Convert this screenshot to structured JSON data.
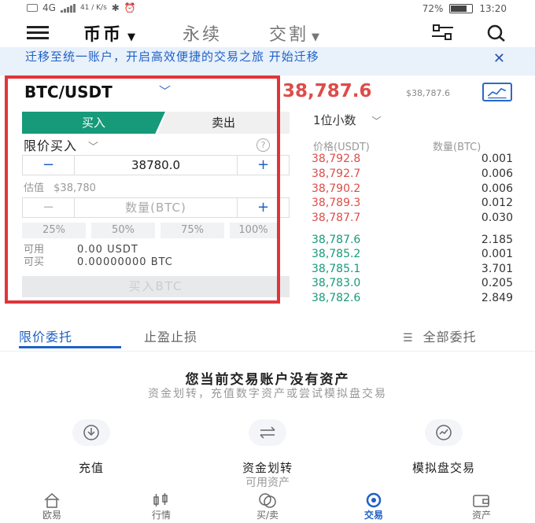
{
  "status_bar": {
    "network": "4G",
    "speed": "41 / K/s",
    "battery": "72%",
    "time": "13:20"
  },
  "top_nav": {
    "tabs": [
      "币币",
      "永续",
      "交割"
    ]
  },
  "banner": {
    "text": "迁移至统一账户，开启高效便捷的交易之旅 开始迁移",
    "close": "✕"
  },
  "pair": {
    "name": "BTC/USDT"
  },
  "order_form": {
    "buy_label": "买入",
    "sell_label": "卖出",
    "order_type": "限价买入",
    "price_value": "38780.0",
    "estimate_label": "估值",
    "estimate_value": "$38,780",
    "amount_placeholder": "数量(BTC)",
    "percents": [
      "25%",
      "50%",
      "75%",
      "100%"
    ],
    "available_label": "可用",
    "buyable_label": "可买",
    "available_value": "0.00 USDT",
    "buyable_value": "0.00000000 BTC",
    "submit_label": "买入BTC"
  },
  "ticker": {
    "last_price": "38,787.6",
    "last_price_usd": "$38,787.6"
  },
  "orderbook": {
    "precision": "1位小数",
    "price_header": "价格(USDT)",
    "qty_header": "数量(BTC)",
    "asks": [
      {
        "price": "38,792.8",
        "qty": "0.001"
      },
      {
        "price": "38,792.7",
        "qty": "0.006"
      },
      {
        "price": "38,790.2",
        "qty": "0.006"
      },
      {
        "price": "38,789.3",
        "qty": "0.012"
      },
      {
        "price": "38,787.7",
        "qty": "0.030"
      }
    ],
    "bids": [
      {
        "price": "38,787.6",
        "qty": "2.185"
      },
      {
        "price": "38,785.2",
        "qty": "0.001"
      },
      {
        "price": "38,785.1",
        "qty": "3.701"
      },
      {
        "price": "38,783.0",
        "qty": "0.205"
      },
      {
        "price": "38,782.6",
        "qty": "2.849"
      }
    ]
  },
  "orders_tabs": {
    "limit": "限价委托",
    "tpsl": "止盈止损",
    "all": "全部委托"
  },
  "empty_state": {
    "title": "您当前交易账户没有资产",
    "subtitle": "资金划转，充值数字资产或尝试模拟盘交易",
    "actions": [
      "充值",
      "资金划转",
      "模拟盘交易"
    ],
    "available_assets": "可用资产"
  },
  "bottom_nav": {
    "items": [
      "欧易",
      "行情",
      "买/卖",
      "交易",
      "资产"
    ]
  },
  "colors": {
    "accent_blue": "#1e61c5",
    "buy_green": "#169a7a",
    "sell_red": "#dd4c49",
    "frame_red": "#e0343a"
  }
}
